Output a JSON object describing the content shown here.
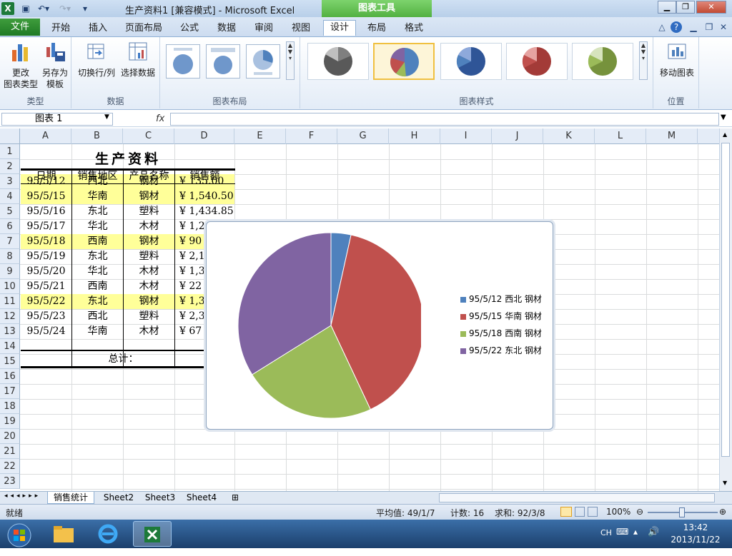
{
  "app": {
    "title": "生产资料1 [兼容模式] - Microsoft Excel",
    "context_tab": "图表工具",
    "app_icon": "X"
  },
  "ribbon_tabs": [
    "文件",
    "开始",
    "插入",
    "页面布局",
    "公式",
    "数据",
    "审阅",
    "视图",
    "设计",
    "布局",
    "格式"
  ],
  "active_tab": "设计",
  "groups": {
    "type": {
      "label": "类型",
      "change_btn": "更改\n图表类型",
      "save_btn": "另存为\n模板"
    },
    "data": {
      "label": "数据",
      "switch_btn": "切换行/列",
      "select_btn": "选择数据"
    },
    "layout": {
      "label": "图表布局"
    },
    "styles": {
      "label": "图表样式"
    },
    "location": {
      "label": "位置",
      "move_btn": "移动图表"
    }
  },
  "formula_bar": {
    "name_box": "图表 1",
    "fx": "fx",
    "formula": ""
  },
  "columns": [
    "A",
    "B",
    "C",
    "D",
    "E",
    "F",
    "G",
    "H",
    "I",
    "J",
    "K",
    "L",
    "M"
  ],
  "rows": [
    "1",
    "2",
    "3",
    "4",
    "5",
    "6",
    "7",
    "8",
    "9",
    "10",
    "11",
    "12",
    "13",
    "14",
    "15",
    "16",
    "17",
    "18",
    "19",
    "20",
    "21",
    "22",
    "23"
  ],
  "sheet": {
    "title": "生产资料",
    "headers": [
      "日期",
      "销售地区",
      "产品名称",
      "销售额"
    ],
    "data": [
      {
        "date": "95/5/12",
        "region": "西北",
        "product": "钢材",
        "amount": "¥    135.00",
        "highlight": true
      },
      {
        "date": "95/5/15",
        "region": "华南",
        "product": "钢材",
        "amount": "¥ 1,540.50",
        "highlight": true
      },
      {
        "date": "95/5/16",
        "region": "东北",
        "product": "塑料",
        "amount": "¥ 1,434.85",
        "highlight": false
      },
      {
        "date": "95/5/17",
        "region": "华北",
        "product": "木材",
        "amount": "¥ 1,20",
        "highlight": false
      },
      {
        "date": "95/5/18",
        "region": "西南",
        "product": "钢材",
        "amount": "¥    90",
        "highlight": true
      },
      {
        "date": "95/5/19",
        "region": "东北",
        "product": "塑料",
        "amount": "¥ 2,18",
        "highlight": false
      },
      {
        "date": "95/5/20",
        "region": "华北",
        "product": "木材",
        "amount": "¥ 1,35",
        "highlight": false
      },
      {
        "date": "95/5/21",
        "region": "西南",
        "product": "木材",
        "amount": "¥    22",
        "highlight": false
      },
      {
        "date": "95/5/22",
        "region": "东北",
        "product": "钢材",
        "amount": "¥ 1,32",
        "highlight": true
      },
      {
        "date": "95/5/23",
        "region": "西北",
        "product": "塑料",
        "amount": "¥ 2,32",
        "highlight": false
      },
      {
        "date": "95/5/24",
        "region": "华南",
        "product": "木材",
        "amount": "¥    67",
        "highlight": false
      }
    ],
    "total_label": "总计："
  },
  "chart_data": {
    "type": "pie",
    "categories": [
      "95/5/12 西北 钢材",
      "95/5/15 华南 钢材",
      "95/5/18 西南 钢材",
      "95/5/22 东北 钢材"
    ],
    "values": [
      135,
      1540.5,
      900,
      1320
    ],
    "colors": [
      "#4f81bd",
      "#c0504d",
      "#9bbb59",
      "#8064a2"
    ],
    "legend_position": "right"
  },
  "sheet_tabs": [
    "销售统计",
    "Sheet2",
    "Sheet3",
    "Sheet4"
  ],
  "active_sheet": "销售统计",
  "status": {
    "ready": "就绪",
    "average": "平均值: 49/1/7",
    "count": "计数: 16",
    "sum": "求和: 92/3/8",
    "zoom": "100%"
  },
  "taskbar": {
    "lang": "CH",
    "time": "13:42",
    "date": "2013/11/22"
  }
}
